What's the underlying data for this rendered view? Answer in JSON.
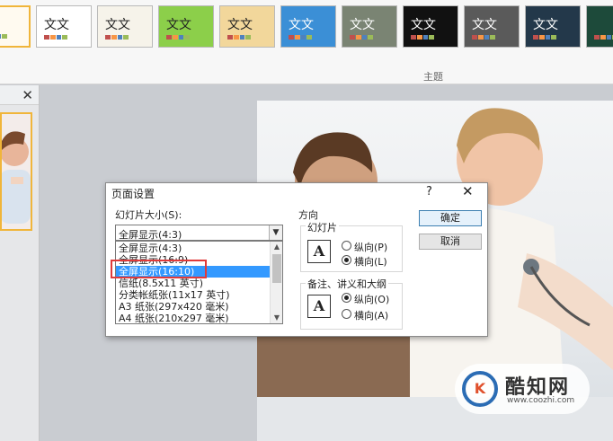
{
  "ribbon": {
    "themes": [
      {
        "text": "",
        "bg": "#fffaf0",
        "selected": true
      },
      {
        "text": "文文",
        "bg": "#ffffff",
        "selected": false
      },
      {
        "text": "文文",
        "bg": "#f6f3ea",
        "selected": false
      },
      {
        "text": "文文",
        "bg": "#8ccf4a",
        "selected": false
      },
      {
        "text": "文文",
        "bg": "#f2d79b",
        "selected": false
      },
      {
        "text": "文文",
        "bg": "#3b8fd6",
        "selected": false
      },
      {
        "text": "文文",
        "bg": "#7a8473",
        "selected": false
      },
      {
        "text": "文文",
        "bg": "#111111",
        "selected": false
      },
      {
        "text": "文文",
        "bg": "#5a5a5a",
        "selected": false
      },
      {
        "text": "文文",
        "bg": "#23384a",
        "selected": false
      },
      {
        "text": "",
        "bg": "#1d4a3a",
        "selected": false
      }
    ],
    "group_label": "主题"
  },
  "thumb_pane": {
    "close": "✕"
  },
  "dialog": {
    "title": "页面设置",
    "help": "?",
    "close": "✕",
    "size_label": "幻灯片大小(S):",
    "size_value": "全屏显示(4:3)",
    "options": [
      "全屏显示(4:3)",
      "全屏显示(16:9)",
      "全屏显示(16:10)",
      "信纸(8.5x11 英寸)",
      "分类帐纸张(11x17 英寸)",
      "A3 纸张(297x420 毫米)",
      "A4 纸张(210x297 毫米)"
    ],
    "selected_option": "全屏显示(16:10)",
    "orientation_label": "方向",
    "slides_label": "幻灯片",
    "slides_portrait": "纵向(P)",
    "slides_landscape": "横向(L)",
    "notes_label": "备注、讲义和大纲",
    "notes_portrait": "纵向(O)",
    "notes_landscape": "横向(A)",
    "ok": "确定",
    "cancel": "取消"
  },
  "watermark": {
    "logo": "K",
    "name": "酷知网",
    "url": "www.coozhi.com"
  },
  "colors": {
    "accent": "#f0b53a",
    "selection": "#3399ff",
    "highlight_box": "#e03a3a"
  }
}
